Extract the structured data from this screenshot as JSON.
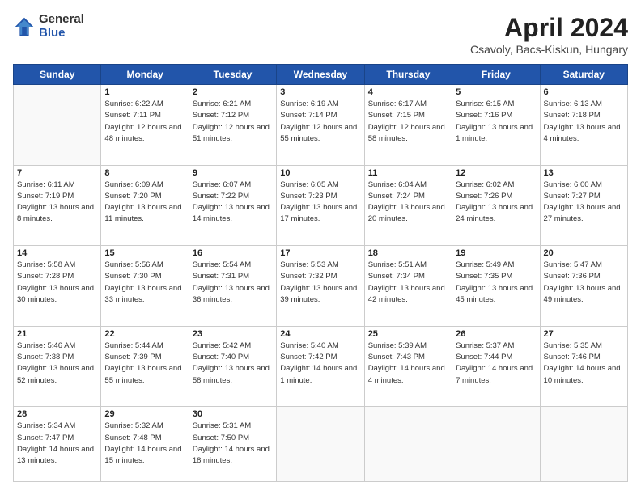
{
  "header": {
    "logo_general": "General",
    "logo_blue": "Blue",
    "month_title": "April 2024",
    "subtitle": "Csavoly, Bacs-Kiskun, Hungary"
  },
  "days_of_week": [
    "Sunday",
    "Monday",
    "Tuesday",
    "Wednesday",
    "Thursday",
    "Friday",
    "Saturday"
  ],
  "weeks": [
    [
      {
        "day": "",
        "sunrise": "",
        "sunset": "",
        "daylight": ""
      },
      {
        "day": "1",
        "sunrise": "Sunrise: 6:22 AM",
        "sunset": "Sunset: 7:11 PM",
        "daylight": "Daylight: 12 hours and 48 minutes."
      },
      {
        "day": "2",
        "sunrise": "Sunrise: 6:21 AM",
        "sunset": "Sunset: 7:12 PM",
        "daylight": "Daylight: 12 hours and 51 minutes."
      },
      {
        "day": "3",
        "sunrise": "Sunrise: 6:19 AM",
        "sunset": "Sunset: 7:14 PM",
        "daylight": "Daylight: 12 hours and 55 minutes."
      },
      {
        "day": "4",
        "sunrise": "Sunrise: 6:17 AM",
        "sunset": "Sunset: 7:15 PM",
        "daylight": "Daylight: 12 hours and 58 minutes."
      },
      {
        "day": "5",
        "sunrise": "Sunrise: 6:15 AM",
        "sunset": "Sunset: 7:16 PM",
        "daylight": "Daylight: 13 hours and 1 minute."
      },
      {
        "day": "6",
        "sunrise": "Sunrise: 6:13 AM",
        "sunset": "Sunset: 7:18 PM",
        "daylight": "Daylight: 13 hours and 4 minutes."
      }
    ],
    [
      {
        "day": "7",
        "sunrise": "Sunrise: 6:11 AM",
        "sunset": "Sunset: 7:19 PM",
        "daylight": "Daylight: 13 hours and 8 minutes."
      },
      {
        "day": "8",
        "sunrise": "Sunrise: 6:09 AM",
        "sunset": "Sunset: 7:20 PM",
        "daylight": "Daylight: 13 hours and 11 minutes."
      },
      {
        "day": "9",
        "sunrise": "Sunrise: 6:07 AM",
        "sunset": "Sunset: 7:22 PM",
        "daylight": "Daylight: 13 hours and 14 minutes."
      },
      {
        "day": "10",
        "sunrise": "Sunrise: 6:05 AM",
        "sunset": "Sunset: 7:23 PM",
        "daylight": "Daylight: 13 hours and 17 minutes."
      },
      {
        "day": "11",
        "sunrise": "Sunrise: 6:04 AM",
        "sunset": "Sunset: 7:24 PM",
        "daylight": "Daylight: 13 hours and 20 minutes."
      },
      {
        "day": "12",
        "sunrise": "Sunrise: 6:02 AM",
        "sunset": "Sunset: 7:26 PM",
        "daylight": "Daylight: 13 hours and 24 minutes."
      },
      {
        "day": "13",
        "sunrise": "Sunrise: 6:00 AM",
        "sunset": "Sunset: 7:27 PM",
        "daylight": "Daylight: 13 hours and 27 minutes."
      }
    ],
    [
      {
        "day": "14",
        "sunrise": "Sunrise: 5:58 AM",
        "sunset": "Sunset: 7:28 PM",
        "daylight": "Daylight: 13 hours and 30 minutes."
      },
      {
        "day": "15",
        "sunrise": "Sunrise: 5:56 AM",
        "sunset": "Sunset: 7:30 PM",
        "daylight": "Daylight: 13 hours and 33 minutes."
      },
      {
        "day": "16",
        "sunrise": "Sunrise: 5:54 AM",
        "sunset": "Sunset: 7:31 PM",
        "daylight": "Daylight: 13 hours and 36 minutes."
      },
      {
        "day": "17",
        "sunrise": "Sunrise: 5:53 AM",
        "sunset": "Sunset: 7:32 PM",
        "daylight": "Daylight: 13 hours and 39 minutes."
      },
      {
        "day": "18",
        "sunrise": "Sunrise: 5:51 AM",
        "sunset": "Sunset: 7:34 PM",
        "daylight": "Daylight: 13 hours and 42 minutes."
      },
      {
        "day": "19",
        "sunrise": "Sunrise: 5:49 AM",
        "sunset": "Sunset: 7:35 PM",
        "daylight": "Daylight: 13 hours and 45 minutes."
      },
      {
        "day": "20",
        "sunrise": "Sunrise: 5:47 AM",
        "sunset": "Sunset: 7:36 PM",
        "daylight": "Daylight: 13 hours and 49 minutes."
      }
    ],
    [
      {
        "day": "21",
        "sunrise": "Sunrise: 5:46 AM",
        "sunset": "Sunset: 7:38 PM",
        "daylight": "Daylight: 13 hours and 52 minutes."
      },
      {
        "day": "22",
        "sunrise": "Sunrise: 5:44 AM",
        "sunset": "Sunset: 7:39 PM",
        "daylight": "Daylight: 13 hours and 55 minutes."
      },
      {
        "day": "23",
        "sunrise": "Sunrise: 5:42 AM",
        "sunset": "Sunset: 7:40 PM",
        "daylight": "Daylight: 13 hours and 58 minutes."
      },
      {
        "day": "24",
        "sunrise": "Sunrise: 5:40 AM",
        "sunset": "Sunset: 7:42 PM",
        "daylight": "Daylight: 14 hours and 1 minute."
      },
      {
        "day": "25",
        "sunrise": "Sunrise: 5:39 AM",
        "sunset": "Sunset: 7:43 PM",
        "daylight": "Daylight: 14 hours and 4 minutes."
      },
      {
        "day": "26",
        "sunrise": "Sunrise: 5:37 AM",
        "sunset": "Sunset: 7:44 PM",
        "daylight": "Daylight: 14 hours and 7 minutes."
      },
      {
        "day": "27",
        "sunrise": "Sunrise: 5:35 AM",
        "sunset": "Sunset: 7:46 PM",
        "daylight": "Daylight: 14 hours and 10 minutes."
      }
    ],
    [
      {
        "day": "28",
        "sunrise": "Sunrise: 5:34 AM",
        "sunset": "Sunset: 7:47 PM",
        "daylight": "Daylight: 14 hours and 13 minutes."
      },
      {
        "day": "29",
        "sunrise": "Sunrise: 5:32 AM",
        "sunset": "Sunset: 7:48 PM",
        "daylight": "Daylight: 14 hours and 15 minutes."
      },
      {
        "day": "30",
        "sunrise": "Sunrise: 5:31 AM",
        "sunset": "Sunset: 7:50 PM",
        "daylight": "Daylight: 14 hours and 18 minutes."
      },
      {
        "day": "",
        "sunrise": "",
        "sunset": "",
        "daylight": ""
      },
      {
        "day": "",
        "sunrise": "",
        "sunset": "",
        "daylight": ""
      },
      {
        "day": "",
        "sunrise": "",
        "sunset": "",
        "daylight": ""
      },
      {
        "day": "",
        "sunrise": "",
        "sunset": "",
        "daylight": ""
      }
    ]
  ]
}
